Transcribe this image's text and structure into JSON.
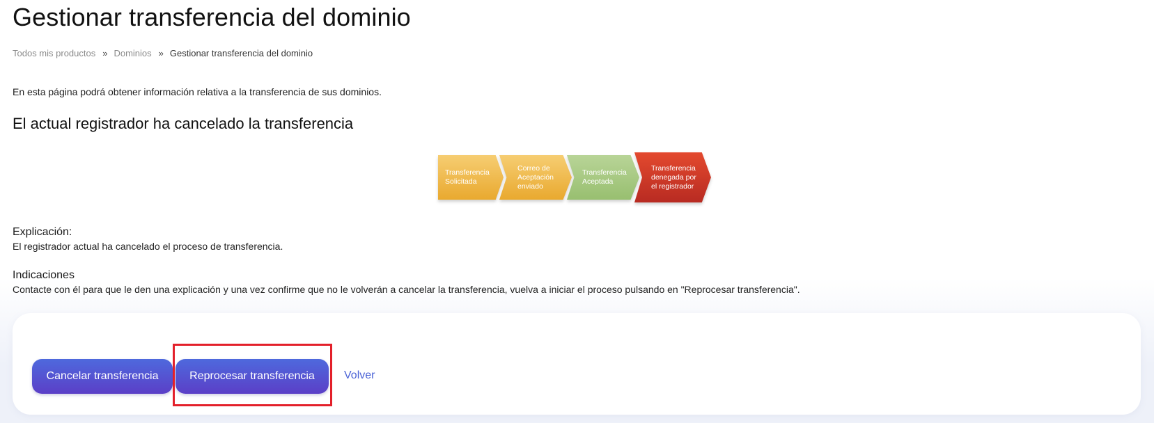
{
  "page": {
    "title": "Gestionar transferencia del dominio",
    "breadcrumb": [
      {
        "label": "Todos mis productos"
      },
      {
        "label": "Dominios"
      },
      {
        "label": "Gestionar transferencia del dominio"
      }
    ],
    "breadcrumb_separator": "»",
    "intro": "En esta página podrá obtener información relativa a la transferencia de sus dominios.",
    "status_heading": "El actual registrador ha cancelado la transferencia"
  },
  "process_steps": [
    {
      "line1": "Transferencia",
      "line2": "Solicitada",
      "line3": "",
      "color": "#ecb13c"
    },
    {
      "line1": "Correo de",
      "line2": "Aceptación",
      "line3": "enviado",
      "color": "#ecb13c"
    },
    {
      "line1": "Transferencia",
      "line2": "Aceptada",
      "line3": "",
      "color": "#a3c87d"
    },
    {
      "line1": "Transferencia",
      "line2": "denegada por",
      "line3": "el registrador",
      "color": "#c8332a"
    }
  ],
  "explanation": {
    "label": "Explicación:",
    "text": "El registrador actual ha cancelado el proceso de transferencia."
  },
  "indications": {
    "label": "Indicaciones",
    "text": "Contacte con él para que le den una explicación y una vez confirme que no le volverán a cancelar la transferencia, vuelva a iniciar el proceso pulsando en \"Reprocesar transferencia\"."
  },
  "actions": {
    "cancel_label": "Cancelar transferencia",
    "reprocess_label": "Reprocesar transferencia",
    "back_label": "Volver"
  },
  "colors": {
    "button_gradient_start": "#4e69dd",
    "button_gradient_end": "#5b3fc7",
    "link": "#4b63d6",
    "highlight_border": "#e3202a"
  }
}
